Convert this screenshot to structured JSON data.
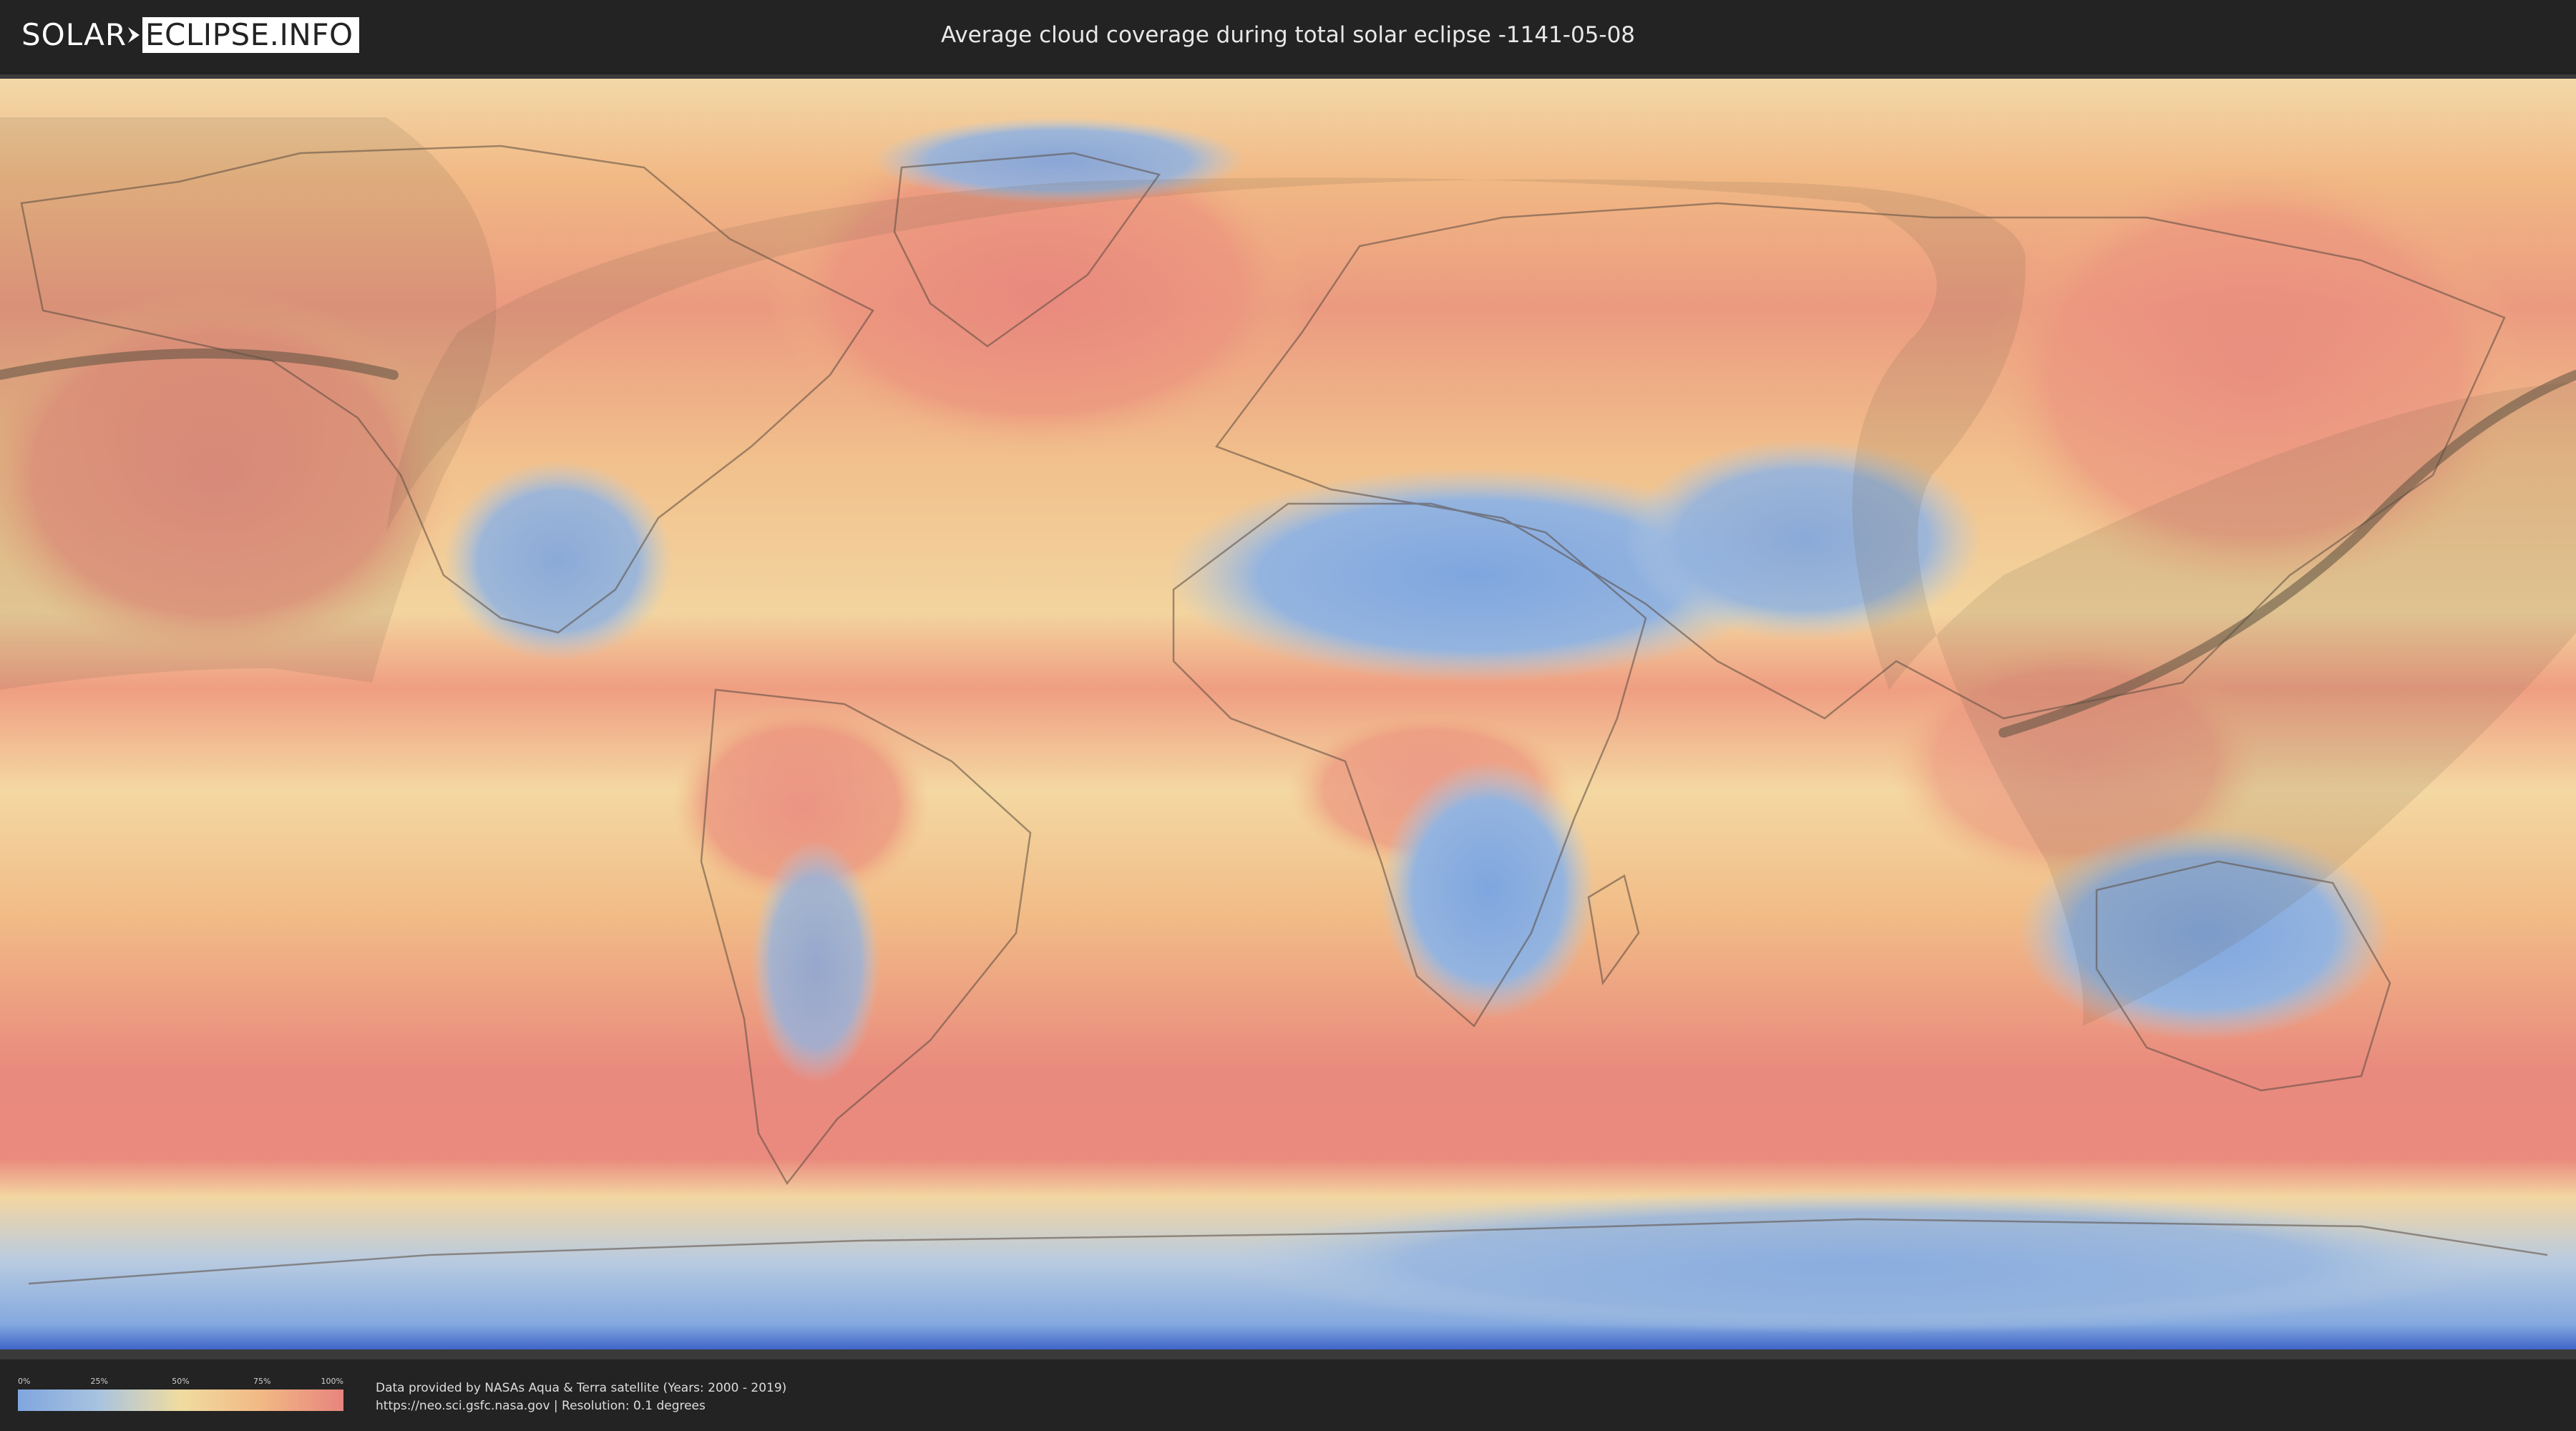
{
  "logo": {
    "left_text": "SOLAR",
    "right_text": "ECLIPSE.INFO"
  },
  "header": {
    "title": "Average cloud coverage during total solar eclipse -1141-05-08"
  },
  "map": {
    "colors": {
      "clear": "#7fa6df",
      "low": "#a9c3df",
      "mid": "#f0dca0",
      "high": "#f1b884",
      "cloudy": "#e8847e",
      "border": "#4a4a4a"
    }
  },
  "legend": {
    "ticks": [
      "0%",
      "25%",
      "50%",
      "75%",
      "100%"
    ]
  },
  "footer": {
    "credit_line1": "Data provided by NASAs Aqua & Terra satellite (Years: 2000 - 2019)",
    "credit_line2": "https://neo.sci.gsfc.nasa.gov | Resolution: 0.1 degrees"
  }
}
